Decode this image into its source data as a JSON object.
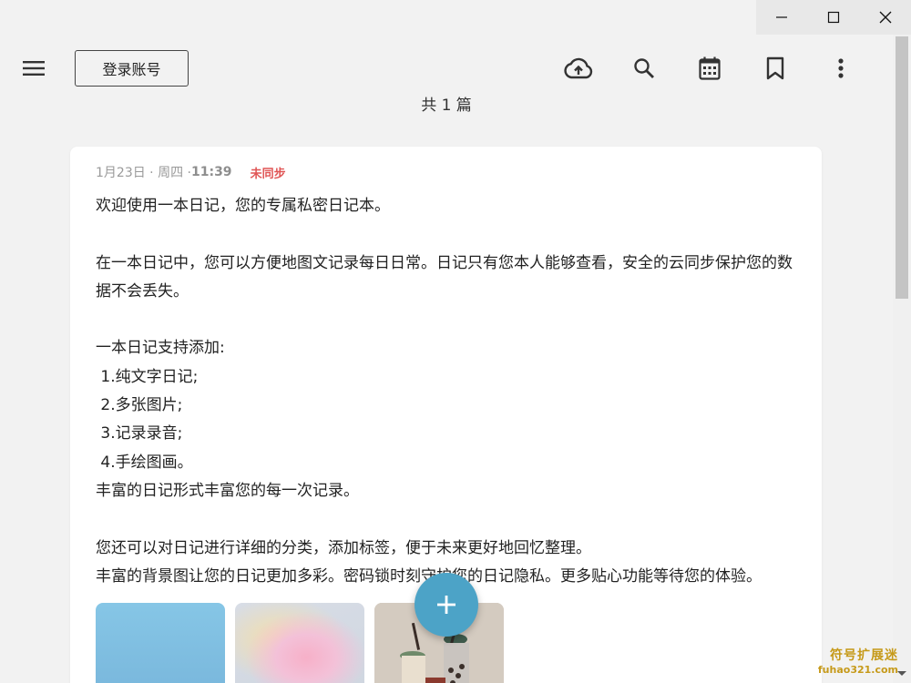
{
  "window_controls": {
    "minimize": "minimize-icon",
    "maximize": "maximize-icon",
    "close": "close-icon"
  },
  "topbar": {
    "menu_icon": "menu-icon",
    "login_label": "登录账号",
    "icons": [
      "cloud-upload-icon",
      "search-icon",
      "calendar-icon",
      "bookmark-icon",
      "more-vert-icon"
    ]
  },
  "count_label": "共 1 篇",
  "entry": {
    "date": "1月23日 · 周四 · ",
    "time": "11:39",
    "sync_status": "未同步",
    "body": "欢迎使用一本日记，您的专属私密日记本。\n\n在一本日记中，您可以方便地图文记录每日日常。日记只有您本人能够查看，安全的云同步保护您的数据不会丢失。\n\n一本日记支持添加:\n 1.纯文字日记;\n 2.多张图片;\n 3.记录录音;\n 4.手绘图画。\n丰富的日记形式丰富您的每一次记录。\n\n您还可以对日记进行详细的分类，添加标签，便于未来更好地回忆整理。\n丰富的背景图让您的日记更加多彩。密码锁时刻守护您的日记隐私。更多贴心功能等待您的体验。",
    "images": [
      "image-sky",
      "image-abstract",
      "image-bubble-tea"
    ]
  },
  "fab": {
    "icon": "plus-icon"
  },
  "colors": {
    "accent": "#4ca3c7",
    "unsynced": "#e05555",
    "background": "#f2f2f2"
  },
  "watermark": {
    "name": "符号扩展迷",
    "url": "fuhao321.com"
  }
}
